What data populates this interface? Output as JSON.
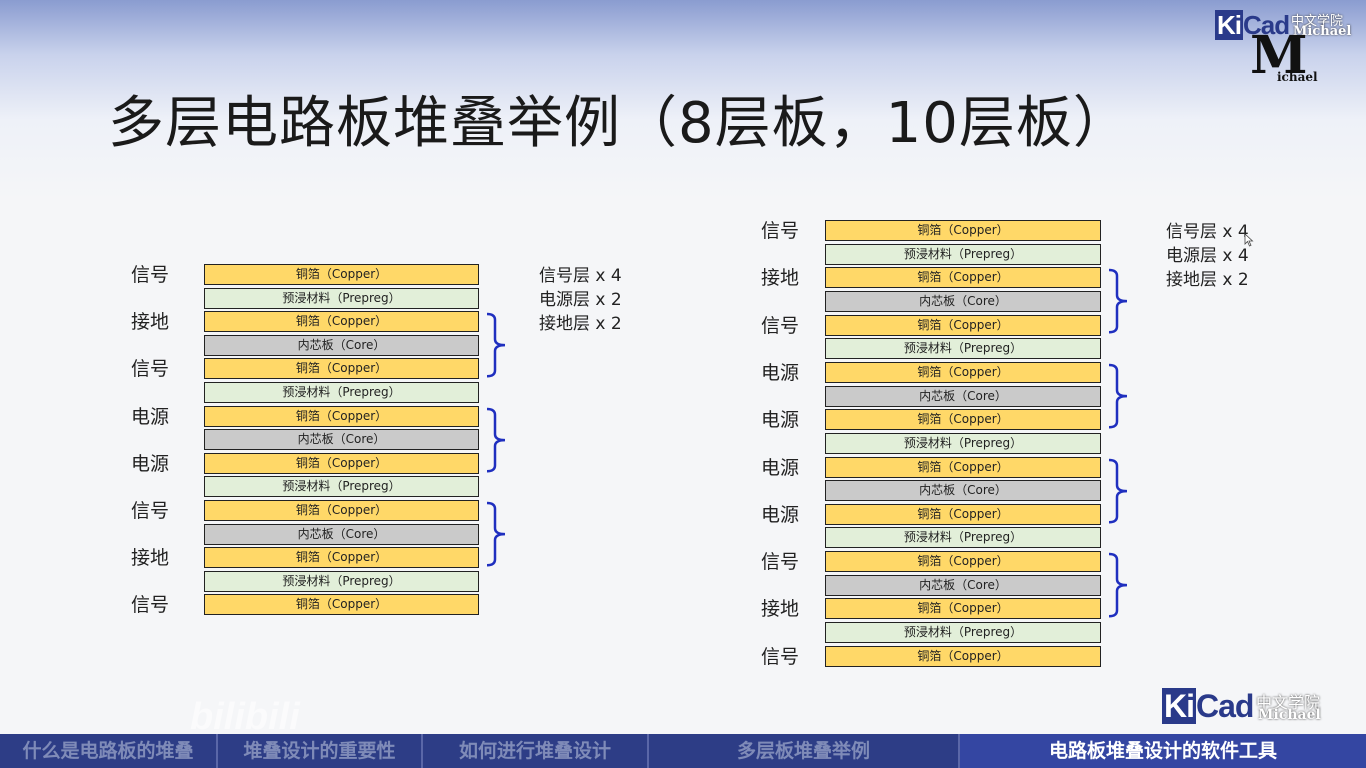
{
  "title": "多层电路板堆叠举例（8层板，10层板）",
  "logo_top": {
    "brand_ki": "Ki",
    "brand_cad": "Cad",
    "cn": "中文学院",
    "michael": "Michael",
    "m": "M",
    "sub": "ichael"
  },
  "logo_bottom": {
    "brand_ki": "Ki",
    "brand_cad": "Cad",
    "cn": "中文学院",
    "michael": "Michael"
  },
  "watermark": "bilibili",
  "stack8": {
    "layers": [
      {
        "type": "copper",
        "label": "铜箔（Copper）"
      },
      {
        "type": "prepreg",
        "label": "预浸材料（Prepreg）"
      },
      {
        "type": "copper",
        "label": "铜箔（Copper）"
      },
      {
        "type": "core",
        "label": "内芯板（Core）"
      },
      {
        "type": "copper",
        "label": "铜箔（Copper）"
      },
      {
        "type": "prepreg",
        "label": "预浸材料（Prepreg）"
      },
      {
        "type": "copper",
        "label": "铜箔（Copper）"
      },
      {
        "type": "core",
        "label": "内芯板（Core）"
      },
      {
        "type": "copper",
        "label": "铜箔（Copper）"
      },
      {
        "type": "prepreg",
        "label": "预浸材料（Prepreg）"
      },
      {
        "type": "copper",
        "label": "铜箔（Copper）"
      },
      {
        "type": "core",
        "label": "内芯板（Core）"
      },
      {
        "type": "copper",
        "label": "铜箔（Copper）"
      },
      {
        "type": "prepreg",
        "label": "预浸材料（Prepreg）"
      },
      {
        "type": "copper",
        "label": "铜箔（Copper）"
      }
    ],
    "side_labels": [
      "信号",
      "接地",
      "信号",
      "电源",
      "电源",
      "信号",
      "接地",
      "信号"
    ],
    "summary": [
      "信号层 x 4",
      "电源层 x 2",
      "接地层 x 2"
    ]
  },
  "stack10": {
    "layers": [
      {
        "type": "copper",
        "label": "铜箔（Copper）"
      },
      {
        "type": "prepreg",
        "label": "预浸材料（Prepreg）"
      },
      {
        "type": "copper",
        "label": "铜箔（Copper）"
      },
      {
        "type": "core",
        "label": "内芯板（Core）"
      },
      {
        "type": "copper",
        "label": "铜箔（Copper）"
      },
      {
        "type": "prepreg",
        "label": "预浸材料（Prepreg）"
      },
      {
        "type": "copper",
        "label": "铜箔（Copper）"
      },
      {
        "type": "core",
        "label": "内芯板（Core）"
      },
      {
        "type": "copper",
        "label": "铜箔（Copper）"
      },
      {
        "type": "prepreg",
        "label": "预浸材料（Prepreg）"
      },
      {
        "type": "copper",
        "label": "铜箔（Copper）"
      },
      {
        "type": "core",
        "label": "内芯板（Core）"
      },
      {
        "type": "copper",
        "label": "铜箔（Copper）"
      },
      {
        "type": "prepreg",
        "label": "预浸材料（Prepreg）"
      },
      {
        "type": "copper",
        "label": "铜箔（Copper）"
      },
      {
        "type": "core",
        "label": "内芯板（Core）"
      },
      {
        "type": "copper",
        "label": "铜箔（Copper）"
      },
      {
        "type": "prepreg",
        "label": "预浸材料（Prepreg）"
      },
      {
        "type": "copper",
        "label": "铜箔（Copper）"
      }
    ],
    "side_labels": [
      "信号",
      "接地",
      "信号",
      "电源",
      "电源",
      "电源",
      "电源",
      "信号",
      "接地",
      "信号"
    ],
    "summary": [
      "信号层 x 4",
      "电源层 x 4",
      "接地层 x 2"
    ]
  },
  "colors": {
    "copper": "#ffd868",
    "prepreg": "#e2efd9",
    "core": "#cacaca",
    "bracket": "#1f2fbf",
    "nav_bg": "#2d3d86"
  },
  "nav": [
    {
      "label": "什么是电路板的堆叠",
      "active": false
    },
    {
      "label": "堆叠设计的重要性",
      "active": false
    },
    {
      "label": "如何进行堆叠设计",
      "active": false
    },
    {
      "label": "多层板堆叠举例",
      "active": false
    },
    {
      "label": "电路板堆叠设计的软件工具",
      "active": true
    }
  ]
}
